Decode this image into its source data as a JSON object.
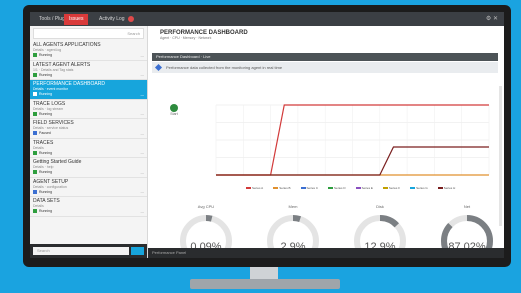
{
  "tabs": [
    {
      "label": "Tools / Plug"
    },
    {
      "label": "Issues"
    },
    {
      "label": "Activity Log"
    }
  ],
  "sidebar": {
    "search_placeholder": "Search",
    "items": [
      {
        "title": "ALL AGENTS APPLICATIONS",
        "sub": "Details · agent.log",
        "status": "Running",
        "status_color": "#2e9e3e",
        "time": "—"
      },
      {
        "title": "LATEST AGENT ALERTS",
        "sub": "1/1 · Details and Tag stats",
        "status": "Running",
        "status_color": "#2e9e3e",
        "time": "—"
      },
      {
        "title": "PERFORMANCE DASHBOARD",
        "sub": "Details · event monitor",
        "status": "Running",
        "status_color": "#ffffff",
        "time": "—"
      },
      {
        "title": "TRACE LOGS",
        "sub": "Details · log stream",
        "status": "Running",
        "status_color": "#2e9e3e",
        "time": "—"
      },
      {
        "title": "FIELD SERVICES",
        "sub": "Details · service status",
        "status": "Paused",
        "status_color": "#3b6fd1",
        "time": "—"
      },
      {
        "title": "TRACES",
        "sub": "Details",
        "status": "Running",
        "status_color": "#2e9e3e",
        "time": "—"
      },
      {
        "title": "Getting Started Guide",
        "sub": "Details · help",
        "status": "Running",
        "status_color": "#2e9e3e",
        "time": "—"
      },
      {
        "title": "AGENT SETUP",
        "sub": "Details · configuration",
        "status": "Running",
        "status_color": "#3b6fd1",
        "time": "—"
      },
      {
        "title": "DATA SETS",
        "sub": "Details",
        "status": "Running",
        "status_color": "#2e9e3e",
        "time": "—"
      }
    ],
    "footer_placeholder": "Search"
  },
  "main": {
    "title": "PERFORMANCE DASHBOARD",
    "subtitle": "Agent · CPU · Memory · Network",
    "banner": "Performance Dashboard · Live",
    "info": "Performance data collected from the monitoring agent in real time",
    "run_label": "Start",
    "legend": [
      {
        "label": "Series A",
        "color": "#d23a3a"
      },
      {
        "label": "Series B",
        "color": "#e0902f"
      },
      {
        "label": "Series C",
        "color": "#3b6fd1"
      },
      {
        "label": "Series D",
        "color": "#2e9e3e"
      },
      {
        "label": "Series E",
        "color": "#8a4fc0"
      },
      {
        "label": "Series F",
        "color": "#c2a000"
      },
      {
        "label": "Series G",
        "color": "#17a5dc"
      },
      {
        "label": "Series H",
        "color": "#7a1f1f"
      }
    ],
    "gauges": [
      {
        "label": "Avg CPU",
        "value": "0.09%",
        "fraction": 0.04
      },
      {
        "label": "Mem",
        "value": "2.9%",
        "fraction": 0.05
      },
      {
        "label": "Disk",
        "value": "12.9%",
        "fraction": 0.13
      },
      {
        "label": "Net",
        "value": "87.02%",
        "fraction": 0.87
      }
    ],
    "footer": "Performance Panel"
  },
  "chart_data": {
    "type": "line",
    "x": [
      0,
      1,
      2,
      3,
      4,
      5,
      6,
      7,
      8,
      9,
      10,
      11,
      12,
      13,
      14,
      15,
      16,
      17,
      18,
      19,
      20
    ],
    "series": [
      {
        "color": "#d23a3a",
        "values": [
          0,
          0,
          0,
          0,
          0,
          100,
          100,
          100,
          100,
          100,
          100,
          100,
          100,
          100,
          100,
          100,
          100,
          100,
          100,
          100,
          100
        ]
      },
      {
        "color": "#e0902f",
        "values": [
          0,
          0,
          0,
          0,
          0,
          0,
          0,
          0,
          0,
          0,
          0,
          0,
          0,
          0,
          0,
          0,
          0,
          0,
          0,
          0,
          0
        ]
      },
      {
        "color": "#7a1f1f",
        "values": [
          0,
          0,
          0,
          0,
          0,
          0,
          0,
          0,
          0,
          0,
          0,
          0,
          0,
          40,
          40,
          40,
          40,
          40,
          40,
          40,
          40
        ]
      }
    ],
    "ylim": [
      0,
      100
    ],
    "grid": true
  },
  "colors": {
    "accent": "#17a5dc",
    "active_tab": "#d93a3a",
    "dark_bar": "#3b3f44"
  }
}
